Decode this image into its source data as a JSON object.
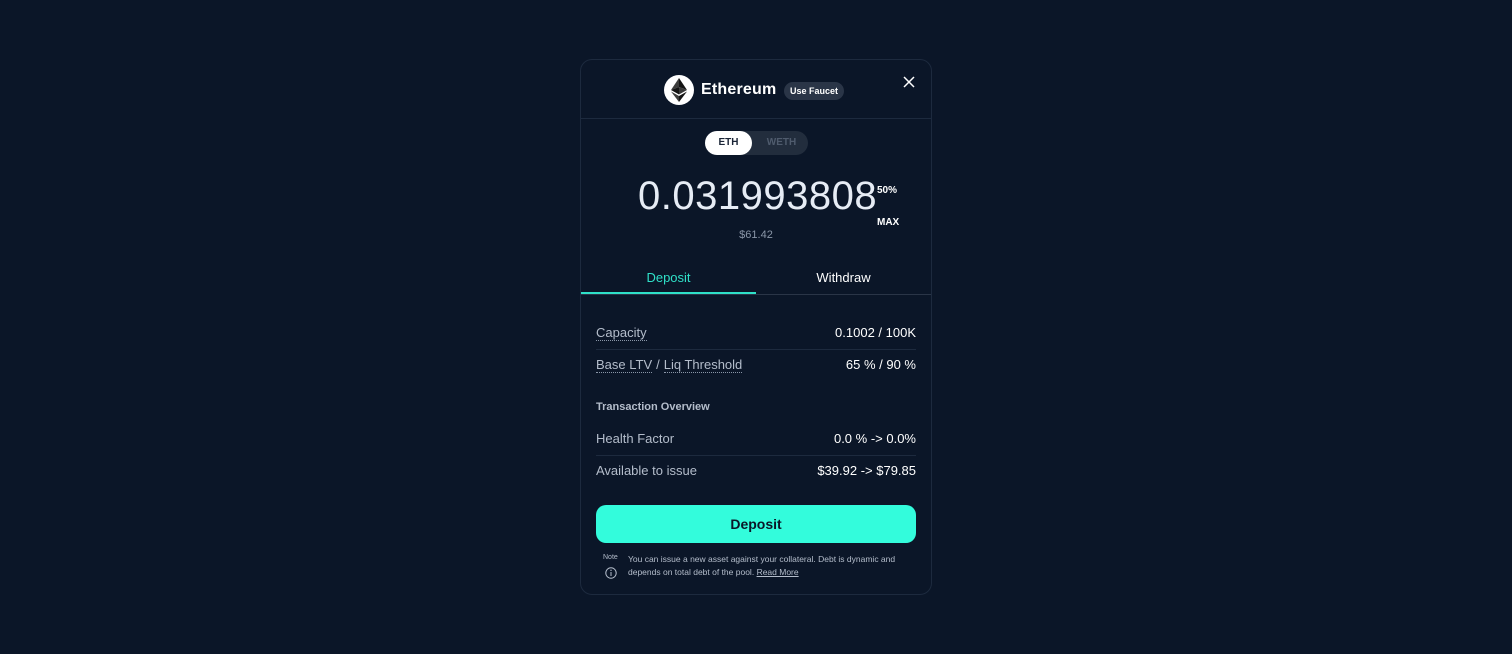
{
  "header": {
    "token_name": "Ethereum",
    "faucet_label": "Use Faucet",
    "token_icon": "ethereum-icon",
    "close_icon": "close-icon"
  },
  "asset_toggle": {
    "options": [
      "ETH",
      "WETH"
    ],
    "selected": "ETH"
  },
  "amount": {
    "value": "0.031993808",
    "usd_value": "$61.42",
    "half_label": "50%",
    "max_label": "MAX"
  },
  "tabs": [
    {
      "label": "Deposit",
      "active": true
    },
    {
      "label": "Withdraw",
      "active": false
    }
  ],
  "info": {
    "capacity_label": "Capacity",
    "capacity_value": "0.1002 / 100K",
    "ltv_label": "Base LTV",
    "separator": "/",
    "liq_label": "Liq Threshold",
    "ltv_value": "65 % / 90 %"
  },
  "overview": {
    "title": "Transaction Overview",
    "health_label": "Health Factor",
    "health_value": "0.0 % -> 0.0%",
    "available_label": "Available to issue",
    "available_value": "$39.92 -> $79.85"
  },
  "action": {
    "button_label": "Deposit"
  },
  "note": {
    "label": "Note",
    "text": "You can issue a new asset against your collateral. Debt is dynamic and depends on total debt of the pool.",
    "link": "Read More",
    "icon": "info-icon"
  },
  "colors": {
    "background": "#0b1628",
    "accent": "#2fe0c8",
    "button": "#33fcdc"
  }
}
